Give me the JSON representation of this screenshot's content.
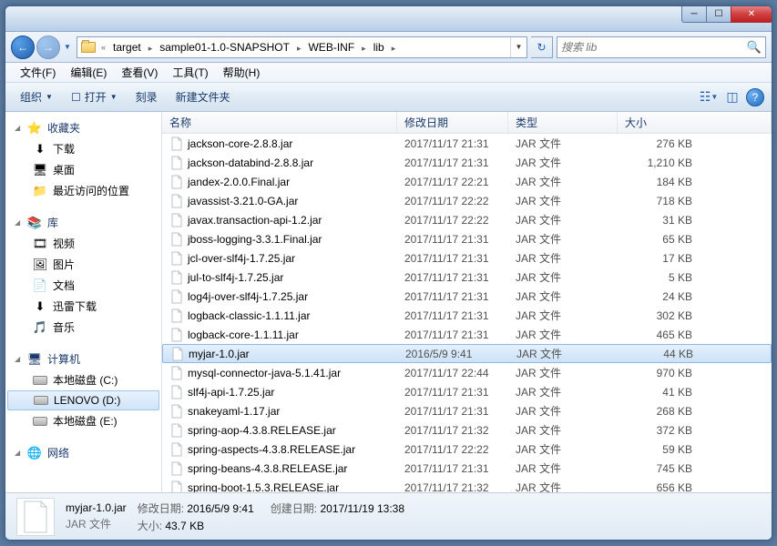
{
  "breadcrumbs": [
    "target",
    "sample01-1.0-SNAPSHOT",
    "WEB-INF",
    "lib"
  ],
  "search_placeholder": "搜索 lib",
  "menus": {
    "file": "文件(F)",
    "edit": "编辑(E)",
    "view": "查看(V)",
    "tools": "工具(T)",
    "help": "帮助(H)"
  },
  "toolbar": {
    "organize": "组织",
    "open": "打开",
    "burn": "刻录",
    "newfolder": "新建文件夹"
  },
  "sidebar": {
    "favorites": {
      "label": "收藏夹",
      "items": [
        {
          "label": "下载",
          "icon": "⬇"
        },
        {
          "label": "桌面",
          "icon": "🖥"
        },
        {
          "label": "最近访问的位置",
          "icon": "📁"
        }
      ]
    },
    "libraries": {
      "label": "库",
      "items": [
        {
          "label": "视频",
          "icon": "🎞"
        },
        {
          "label": "图片",
          "icon": "🖼"
        },
        {
          "label": "文档",
          "icon": "📄"
        },
        {
          "label": "迅雷下载",
          "icon": "⬇"
        },
        {
          "label": "音乐",
          "icon": "🎵"
        }
      ]
    },
    "computer": {
      "label": "计算机",
      "items": [
        {
          "label": "本地磁盘 (C:)",
          "icon": "disk"
        },
        {
          "label": "LENOVO (D:)",
          "icon": "disk",
          "selected": true
        },
        {
          "label": "本地磁盘 (E:)",
          "icon": "disk"
        }
      ]
    },
    "network": {
      "label": "网络"
    }
  },
  "columns": {
    "name": "名称",
    "date": "修改日期",
    "type": "类型",
    "size": "大小"
  },
  "files": [
    {
      "name": "jackson-core-2.8.8.jar",
      "date": "2017/11/17 21:31",
      "type": "JAR 文件",
      "size": "276 KB"
    },
    {
      "name": "jackson-databind-2.8.8.jar",
      "date": "2017/11/17 21:31",
      "type": "JAR 文件",
      "size": "1,210 KB"
    },
    {
      "name": "jandex-2.0.0.Final.jar",
      "date": "2017/11/17 22:21",
      "type": "JAR 文件",
      "size": "184 KB"
    },
    {
      "name": "javassist-3.21.0-GA.jar",
      "date": "2017/11/17 22:22",
      "type": "JAR 文件",
      "size": "718 KB"
    },
    {
      "name": "javax.transaction-api-1.2.jar",
      "date": "2017/11/17 22:22",
      "type": "JAR 文件",
      "size": "31 KB"
    },
    {
      "name": "jboss-logging-3.3.1.Final.jar",
      "date": "2017/11/17 21:31",
      "type": "JAR 文件",
      "size": "65 KB"
    },
    {
      "name": "jcl-over-slf4j-1.7.25.jar",
      "date": "2017/11/17 21:31",
      "type": "JAR 文件",
      "size": "17 KB"
    },
    {
      "name": "jul-to-slf4j-1.7.25.jar",
      "date": "2017/11/17 21:31",
      "type": "JAR 文件",
      "size": "5 KB"
    },
    {
      "name": "log4j-over-slf4j-1.7.25.jar",
      "date": "2017/11/17 21:31",
      "type": "JAR 文件",
      "size": "24 KB"
    },
    {
      "name": "logback-classic-1.1.11.jar",
      "date": "2017/11/17 21:31",
      "type": "JAR 文件",
      "size": "302 KB"
    },
    {
      "name": "logback-core-1.1.11.jar",
      "date": "2017/11/17 21:31",
      "type": "JAR 文件",
      "size": "465 KB"
    },
    {
      "name": "myjar-1.0.jar",
      "date": "2016/5/9 9:41",
      "type": "JAR 文件",
      "size": "44 KB",
      "selected": true
    },
    {
      "name": "mysql-connector-java-5.1.41.jar",
      "date": "2017/11/17 22:44",
      "type": "JAR 文件",
      "size": "970 KB"
    },
    {
      "name": "slf4j-api-1.7.25.jar",
      "date": "2017/11/17 21:31",
      "type": "JAR 文件",
      "size": "41 KB"
    },
    {
      "name": "snakeyaml-1.17.jar",
      "date": "2017/11/17 21:31",
      "type": "JAR 文件",
      "size": "268 KB"
    },
    {
      "name": "spring-aop-4.3.8.RELEASE.jar",
      "date": "2017/11/17 21:32",
      "type": "JAR 文件",
      "size": "372 KB"
    },
    {
      "name": "spring-aspects-4.3.8.RELEASE.jar",
      "date": "2017/11/17 22:22",
      "type": "JAR 文件",
      "size": "59 KB"
    },
    {
      "name": "spring-beans-4.3.8.RELEASE.jar",
      "date": "2017/11/17 21:31",
      "type": "JAR 文件",
      "size": "745 KB"
    },
    {
      "name": "spring-boot-1.5.3.RELEASE.jar",
      "date": "2017/11/17 21:32",
      "type": "JAR 文件",
      "size": "656 KB"
    }
  ],
  "status": {
    "filename": "myjar-1.0.jar",
    "filetype": "JAR 文件",
    "mod_label": "修改日期:",
    "mod_value": "2016/5/9 9:41",
    "size_label": "大小:",
    "size_value": "43.7 KB",
    "created_label": "创建日期:",
    "created_value": "2017/11/19 13:38"
  }
}
